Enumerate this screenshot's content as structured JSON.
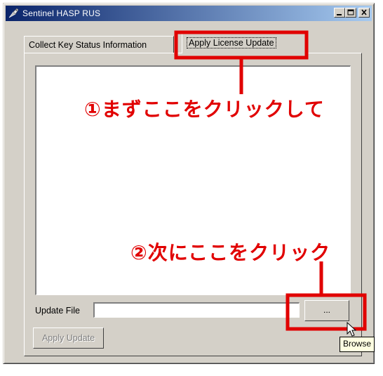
{
  "window": {
    "title": "Sentinel HASP RUS",
    "icon": "sentinel-key-icon"
  },
  "tabs": [
    {
      "label": "Collect Key Status Information",
      "selected": false
    },
    {
      "label": "Apply License Update",
      "selected": true
    }
  ],
  "update_file": {
    "label": "Update File",
    "value": ""
  },
  "browse_button": {
    "label": "..."
  },
  "apply_button": {
    "label": "Apply Update",
    "enabled": false
  },
  "tooltip": {
    "text": "Browse"
  },
  "annotations": {
    "step1": "①まずここをクリックして",
    "step2": "②次にここをクリック",
    "color": "#e10000"
  }
}
